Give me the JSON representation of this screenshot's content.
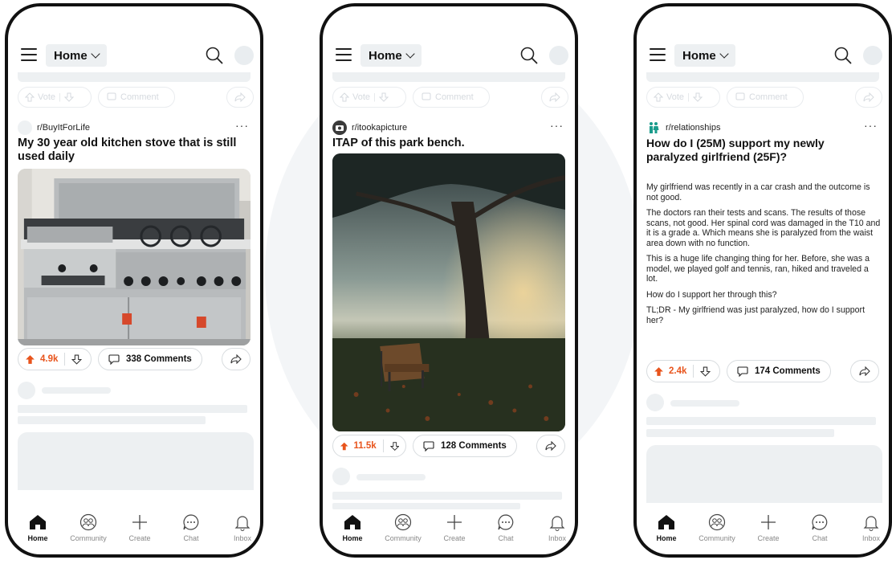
{
  "header": {
    "home_label": "Home"
  },
  "ghost_actions": {
    "vote_label": "Vote",
    "comment_label": "Comment"
  },
  "nav": [
    "Home",
    "Community",
    "Create",
    "Chat",
    "Inbox"
  ],
  "phones": [
    {
      "subreddit": "r/BuyItForLife",
      "more": "···",
      "title": "My 30 year old kitchen stove that is still used daily",
      "upvotes": "4.9k",
      "comments": "338 Comments",
      "image": "stove-photo"
    },
    {
      "subreddit": "r/itookapicture",
      "more": "···",
      "title": "ITAP of this park bench.",
      "upvotes": "11.5k",
      "comments": "128 Comments",
      "image": "park-bench-photo"
    },
    {
      "subreddit": "r/relationships",
      "more": "···",
      "title": "How do I (25M) support my newly paralyzed girlfriend (25F)?",
      "body": [
        "My girlfriend was recently in a car crash and the outcome is not good.",
        "The doctors ran their tests and scans. The results of those scans, not good. Her spinal cord was damaged in the T10 and it is a grade a. Which means she is paralyzed from the waist area down with no function.",
        "This is a huge life changing thing for her. Before, she was a model, we played golf and tennis, ran, hiked and traveled a lot.",
        "How do I support her through this?",
        "TL;DR - My girlfriend was just paralyzed, how do I support her?"
      ],
      "upvotes": "2.4k",
      "comments": "174 Comments"
    }
  ],
  "colors": {
    "upvote_accent": "#e8541c",
    "relationships_icon": "#1a9c8c"
  }
}
